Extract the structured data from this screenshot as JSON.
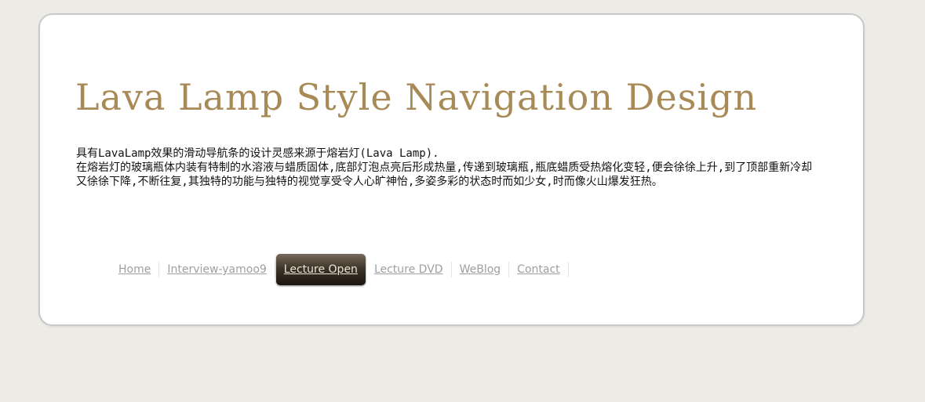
{
  "header": {
    "title": "Lava Lamp Style Navigation Design"
  },
  "description": {
    "line1": "具有LavaLamp效果的滑动导航条的设计灵感来源于熔岩灯(Lava Lamp).",
    "line2": "在熔岩灯的玻璃瓶体内装有特制的水溶液与蜡质固体,底部灯泡点亮后形成热量,传递到玻璃瓶,瓶底蜡质受热熔化变轻,便会徐徐上升,到了顶部重新冷却又徐徐下降,不断往复,其独特的功能与独特的视觉享受令人心旷神怡,多姿多彩的状态时而如少女,时而像火山爆发狂热。"
  },
  "nav": {
    "items": [
      {
        "label": "Home"
      },
      {
        "label": "Interview-yamoo9"
      },
      {
        "label": "Lecture Open"
      },
      {
        "label": "Lecture DVD"
      },
      {
        "label": "WeBlog"
      },
      {
        "label": "Contact"
      }
    ],
    "active_index": 2
  },
  "colors": {
    "title": "#a88a57",
    "page_background": "#ecebe6",
    "card_background": "#ffffff",
    "nav_link": "#9f9f9f",
    "lava_highlight": "#3e3429",
    "lava_text": "#ece5d6"
  }
}
